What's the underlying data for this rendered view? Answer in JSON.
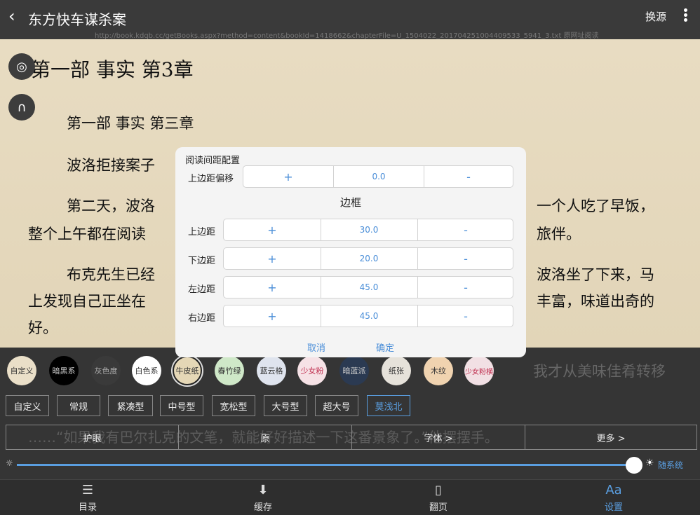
{
  "topbar": {
    "back_icon": "chevron-left-icon",
    "title": "东方快车谋杀案",
    "source_button": "换源",
    "more_icon": "more-vertical-icon",
    "url": "http://book.kdqb.cc/getBooks.aspx?method=content&bookId=1418662&chapterFile=U_1504022_201704251004409533_5941_3.txt 原网址阅读"
  },
  "reader": {
    "chapter_title": "第一部  事实  第3章",
    "paragraphs": [
      "第一部  事实  第三章",
      "波洛拒接案子",
      "第二天，波洛",
      "一个人吃了早饭，",
      "整个上午都在阅读",
      "旅伴。",
      "布克先生已经",
      "波洛坐了下来，马",
      "上发现自己正坐在",
      "丰富，味道出奇的",
      "好。"
    ],
    "lower_text": [
      "……“如果我有巴尔扎克的文笔，就能好好描述一下这番景象了。”他摆摆手。",
      "我才从美味佳肴转移"
    ],
    "side_buttons": [
      "target-icon",
      "headphones-icon"
    ]
  },
  "dialog": {
    "title": "阅读间距配置",
    "top_offset": {
      "label": "上边距偏移",
      "plus": "+",
      "value": "0.0",
      "minus": "-"
    },
    "section_label": "边框",
    "rows": [
      {
        "label": "上边距",
        "plus": "+",
        "value": "30.0",
        "minus": "-"
      },
      {
        "label": "下边距",
        "plus": "+",
        "value": "20.0",
        "minus": "-"
      },
      {
        "label": "左边距",
        "plus": "+",
        "value": "45.0",
        "minus": "-"
      },
      {
        "label": "右边距",
        "plus": "+",
        "value": "45.0",
        "minus": "-"
      }
    ],
    "cancel": "取消",
    "confirm": "确定"
  },
  "themes": [
    {
      "label": "自定义",
      "color": "#eadfc8",
      "text": "#333"
    },
    {
      "label": "暗黑系",
      "color": "#000000",
      "text": "#ccc"
    },
    {
      "label": "灰色度",
      "color": "#3a3a3a",
      "text": "#aaa"
    },
    {
      "label": "白色系",
      "color": "#ffffff",
      "text": "#333"
    },
    {
      "label": "牛皮纸",
      "color": "#e5d7b6",
      "text": "#333",
      "selected": true
    },
    {
      "label": "春竹绿",
      "color": "#cfe8c8",
      "text": "#333"
    },
    {
      "label": "蓝云格",
      "color": "#dfe4ee",
      "text": "#333"
    },
    {
      "label": "少女粉",
      "color": "#f6e2e6",
      "text": "#c03050"
    },
    {
      "label": "暗蓝派",
      "color": "#2b3a52",
      "text": "#ccc"
    },
    {
      "label": "纸张",
      "color": "#e6e2da",
      "text": "#333"
    },
    {
      "label": "木纹",
      "color": "#f0d3b0",
      "text": "#333"
    },
    {
      "label": "少女粉横",
      "color": "#f2e0e4",
      "text": "#c03050"
    }
  ],
  "presets": [
    {
      "label": "自定义"
    },
    {
      "label": "常规"
    },
    {
      "label": "紧凑型"
    },
    {
      "label": "中号型"
    },
    {
      "label": "宽松型"
    },
    {
      "label": "大号型"
    },
    {
      "label": "超大号"
    },
    {
      "label": "莫浅北",
      "active": true
    }
  ],
  "options": [
    {
      "label": "护眼"
    },
    {
      "label": "原"
    },
    {
      "label": "字体 >"
    },
    {
      "label": "更多 >"
    }
  ],
  "brightness": {
    "low_icon": "sun-small-icon",
    "high_icon": "sun-large-icon",
    "follow_system": "随系统",
    "level": 0.98
  },
  "tabs": [
    {
      "label": "目录",
      "icon": "list-icon"
    },
    {
      "label": "缓存",
      "icon": "download-icon"
    },
    {
      "label": "翻页",
      "icon": "book-icon"
    },
    {
      "label": "设置",
      "icon": "font-settings-icon",
      "active": true
    }
  ]
}
